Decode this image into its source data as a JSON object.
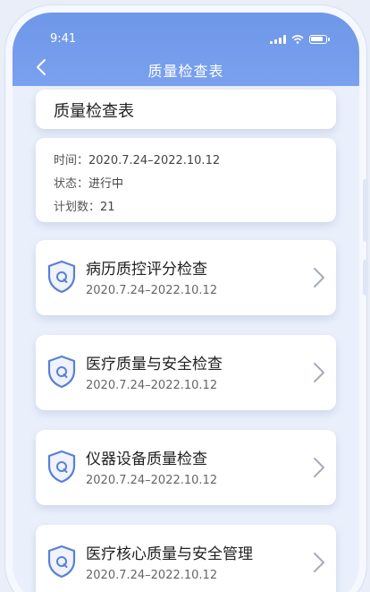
{
  "status_bar": {
    "time": "9:41"
  },
  "nav": {
    "title": "质量检查表"
  },
  "title_card": {
    "title": "质量检查表"
  },
  "info": {
    "time_label": "时间：",
    "time_value": "2020.7.24–2022.10.12",
    "status_label": "状态：",
    "status_value": "进行中",
    "plan_label": "计划数：",
    "plan_value": "21"
  },
  "items": [
    {
      "name": "病历质控评分检查",
      "date": "2020.7.24–2022.10.12"
    },
    {
      "name": "医疗质量与安全检查",
      "date": "2020.7.24–2022.10.12"
    },
    {
      "name": "仪器设备质量检查",
      "date": "2020.7.24–2022.10.12"
    },
    {
      "name": "医疗核心质量与安全管理",
      "date": "2020.7.24–2022.10.12"
    }
  ],
  "colors": {
    "header": "#7aa1ef",
    "shield": "#5b7fd6",
    "background": "#eaf0fb"
  },
  "icons": {
    "back": "chevron-left-icon",
    "item": "shield-q-icon",
    "more": "chevron-right-icon"
  }
}
